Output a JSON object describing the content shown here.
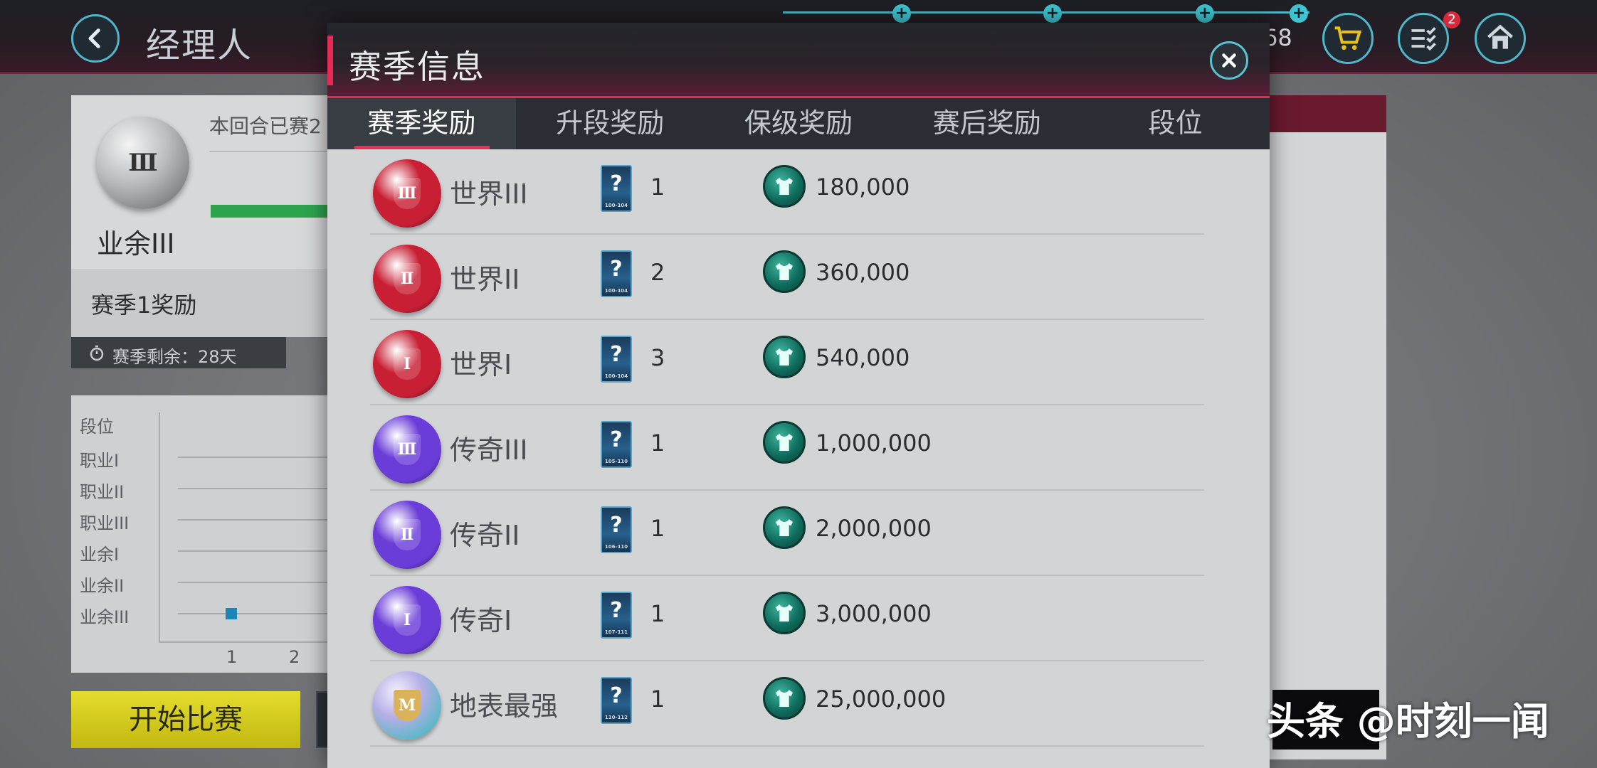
{
  "app": {
    "title": "经理人",
    "currency_value": "68",
    "notification_count": "2"
  },
  "left": {
    "rank_name": "业余III",
    "rank_numeral": "Ⅲ",
    "round_text": "本回合已赛2",
    "season_title": "赛季1奖励",
    "remaining_label": "赛季剩余：28天",
    "chart_axis_title": "段位",
    "chart_levels": [
      "职业I",
      "职业II",
      "职业III",
      "业余I",
      "业余II",
      "业余III"
    ],
    "chart_x": [
      "1",
      "2"
    ],
    "start_button": "开始比赛"
  },
  "modal": {
    "title": "赛季信息",
    "tabs": [
      "赛季奖励",
      "升段奖励",
      "保级奖励",
      "赛后奖励",
      "段位"
    ],
    "active_tab": 0,
    "rows": [
      {
        "tier": "世界III",
        "numeral": "Ⅲ",
        "card_count": "1",
        "card_range": "100-104",
        "coins": "180,000",
        "ball_color": "#c81f34"
      },
      {
        "tier": "世界II",
        "numeral": "Ⅱ",
        "card_count": "2",
        "card_range": "100-104",
        "coins": "360,000",
        "ball_color": "#c81f34"
      },
      {
        "tier": "世界I",
        "numeral": "Ⅰ",
        "card_count": "3",
        "card_range": "100-104",
        "coins": "540,000",
        "ball_color": "#c81f34"
      },
      {
        "tier": "传奇III",
        "numeral": "Ⅲ",
        "card_count": "1",
        "card_range": "105-110",
        "coins": "1,000,000",
        "ball_color": "#6a3cd8"
      },
      {
        "tier": "传奇II",
        "numeral": "Ⅱ",
        "card_count": "1",
        "card_range": "106-110",
        "coins": "2,000,000",
        "ball_color": "#6a3cd8"
      },
      {
        "tier": "传奇I",
        "numeral": "Ⅰ",
        "card_count": "1",
        "card_range": "107-111",
        "coins": "3,000,000",
        "ball_color": "#6a3cd8"
      },
      {
        "tier": "地表最强",
        "numeral": "M",
        "card_count": "1",
        "card_range": "110-112",
        "coins": "25,000,000",
        "ball_color": "#9a8fd0"
      }
    ]
  },
  "watermark": "头条 @时刻一闻"
}
